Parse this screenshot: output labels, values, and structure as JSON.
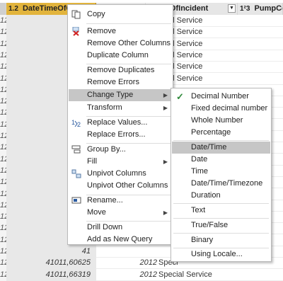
{
  "columns": {
    "col1": {
      "type_icon": "1.2",
      "name": "DateTimeOfCa"
    },
    "col2": {
      "type_icon": "",
      "name": ""
    },
    "col3": {
      "type_icon": "",
      "name": "TypeOfIncident"
    },
    "col4": {
      "type_icon": "1²3",
      "name": "PumpCoun"
    }
  },
  "rows": [
    {
      "index": "121",
      "c1": "410",
      "c2": "",
      "c3": "ecial Service"
    },
    {
      "index": "121",
      "c1": "410",
      "c2": "",
      "c3": "ecial Service"
    },
    {
      "index": "121",
      "c1": "410",
      "c2": "",
      "c3": "ecial Service"
    },
    {
      "index": "121",
      "c1": "410",
      "c2": "",
      "c3": "ecial Service"
    },
    {
      "index": "121",
      "c1": "410",
      "c2": "",
      "c3": "ecial Service"
    },
    {
      "index": "121",
      "c1": "410",
      "c2": "",
      "c3": "ecial Service"
    },
    {
      "index": "121",
      "c1": "410",
      "c2": "",
      "c3": ""
    },
    {
      "index": "121",
      "c1": "410",
      "c2": "",
      "c3": ""
    },
    {
      "index": "121",
      "c1": "410",
      "c2": "",
      "c3": ""
    },
    {
      "index": "121",
      "c1": "410",
      "c2": "",
      "c3": ""
    },
    {
      "index": "121",
      "c1": "410",
      "c2": "",
      "c3": ""
    },
    {
      "index": "121",
      "c1": "410",
      "c2": "",
      "c3": ""
    },
    {
      "index": "121",
      "c1": "410",
      "c2": "",
      "c3": ""
    },
    {
      "index": "121",
      "c1": "410",
      "c2": "",
      "c3": ""
    },
    {
      "index": "121",
      "c1": "410",
      "c2": "",
      "c3": ""
    },
    {
      "index": "121",
      "c1": "410",
      "c2": "",
      "c3": ""
    },
    {
      "index": "121",
      "c1": "410",
      "c2": "",
      "c3": ""
    },
    {
      "index": "121",
      "c1": "410",
      "c2": "",
      "c3": ""
    },
    {
      "index": "121",
      "c1": "41",
      "c2": "",
      "c3": ""
    },
    {
      "index": "121",
      "c1": "41",
      "c2": "",
      "c3": ""
    },
    {
      "index": "121",
      "c1": "41",
      "c2": "",
      "c3": ""
    },
    {
      "index": "121",
      "c1": "41011,60625",
      "c2": "2012",
      "c3": "Speci"
    },
    {
      "index": "121",
      "c1": "41011,66319",
      "c2": "2012",
      "c3": "Special Service"
    }
  ],
  "context_menu": {
    "copy": "Copy",
    "remove": "Remove",
    "remove_other_columns": "Remove Other Columns",
    "duplicate_column": "Duplicate Column",
    "remove_duplicates": "Remove Duplicates",
    "remove_errors": "Remove Errors",
    "change_type": "Change Type",
    "transform": "Transform",
    "replace_values": "Replace Values...",
    "replace_errors": "Replace Errors...",
    "group_by": "Group By...",
    "fill": "Fill",
    "unpivot_columns": "Unpivot Columns",
    "unpivot_other_columns": "Unpivot Other Columns",
    "rename": "Rename...",
    "move": "Move",
    "drill_down": "Drill Down",
    "add_as_new_query": "Add as New Query"
  },
  "change_type_submenu": {
    "decimal_number": "Decimal Number",
    "fixed_decimal_number": "Fixed decimal number",
    "whole_number": "Whole Number",
    "percentage": "Percentage",
    "date_time": "Date/Time",
    "date": "Date",
    "time": "Time",
    "date_time_timezone": "Date/Time/Timezone",
    "duration": "Duration",
    "text": "Text",
    "true_false": "True/False",
    "binary": "Binary",
    "using_locale": "Using Locale..."
  },
  "colors": {
    "selected_column_header": "#e2b43c",
    "menu_highlight": "#c6c6c6",
    "checkmark": "#2f8a3a"
  }
}
